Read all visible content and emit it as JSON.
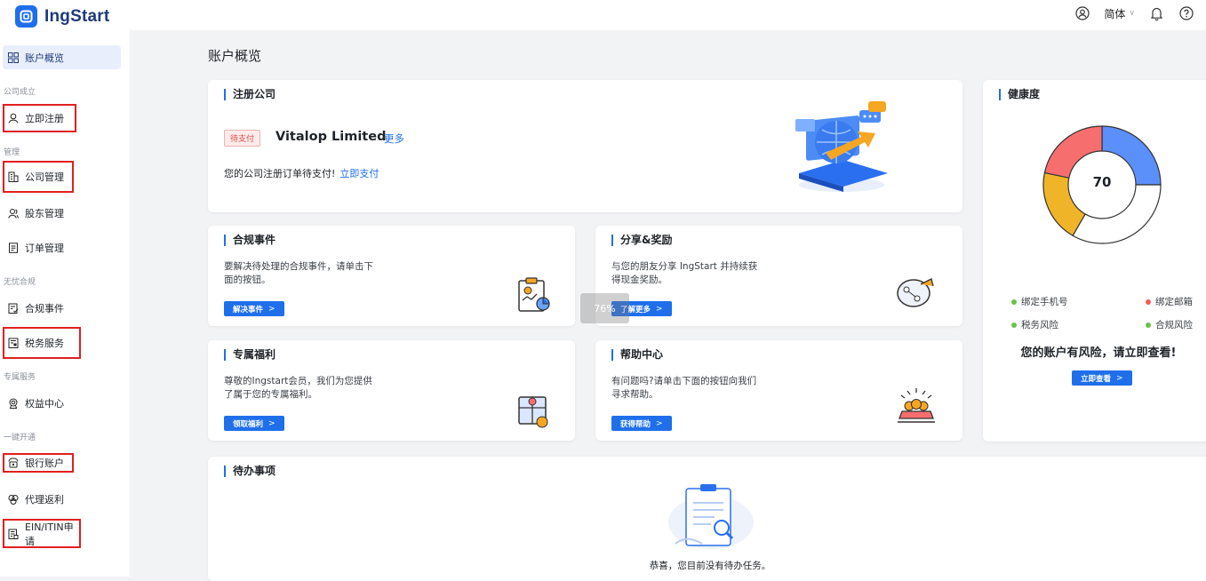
{
  "app": {
    "name": "IngStart"
  },
  "topbar": {
    "language": "简体"
  },
  "sidebar": {
    "overview": "账户概览",
    "section_company": "公司成立",
    "register": "立即注册",
    "section_manage": "管理",
    "company_mgmt": "公司管理",
    "shareholder_mgmt": "股东管理",
    "order_mgmt": "订单管理",
    "section_compliance": "无忧合规",
    "compliance_events": "合规事件",
    "tax_service": "税务服务",
    "section_exclusive": "专属服务",
    "benefits_center": "权益中心",
    "section_oneclick": "一键开通",
    "bank_account": "银行账户",
    "agent_rebate": "代理返利",
    "ein_itin": "EIN/ITIN申请"
  },
  "main": {
    "page_title": "账户概览",
    "register_card": {
      "title": "注册公司",
      "tag": "待支付",
      "company": "Vitalop Limited",
      "more": "更多",
      "message": "您的公司注册订单待支付!",
      "pay_link": "立即支付"
    },
    "compliance_card": {
      "title": "合规事件",
      "desc1": "要解决待处理的合规事件，请单击下",
      "desc2": "面的按钮。",
      "button": "解决事件"
    },
    "share_card": {
      "title": "分享&奖励",
      "desc1": "与您的朋友分享 IngStart 并持续获",
      "desc2": "得现金奖励。",
      "button": "了解更多"
    },
    "benefits_card": {
      "title": "专属福利",
      "desc1": "尊敬的Ingstart会员，我们为您提供",
      "desc2": "了属于您的专属福利。",
      "button": "领取福利"
    },
    "help_card": {
      "title": "帮助中心",
      "desc1": "有问题吗?请单击下面的按钮向我们",
      "desc2": "寻求帮助。",
      "button": "获得帮助"
    },
    "health_card": {
      "title": "健康度",
      "score": "70",
      "legend": [
        {
          "label": "绑定手机号",
          "color": "#52c41a"
        },
        {
          "label": "绑定邮箱",
          "color": "#f5222d"
        },
        {
          "label": "税务风险",
          "color": "#52c41a"
        },
        {
          "label": "合规风险",
          "color": "#52c41a"
        }
      ],
      "risk_text": "您的账户有风险，请立即查看!",
      "button": "立即查看"
    },
    "todo_card": {
      "title": "待办事项",
      "empty": "恭喜，您目前没有待办任务。"
    },
    "overlay_text": "76%"
  },
  "colors": {
    "brand": "#1f6feb",
    "donut": [
      "#5b8ff9",
      "#ffffff",
      "#f0b429",
      "#f76e6e"
    ]
  },
  "chart_data": {
    "type": "pie",
    "title": "健康度",
    "center_label": "70",
    "slices": [
      {
        "value": 25,
        "color": "#5b8ff9"
      },
      {
        "value": 33.3,
        "color": "#ffffff"
      },
      {
        "value": 20,
        "color": "#f0b429"
      },
      {
        "value": 21.7,
        "color": "#f76e6e"
      }
    ]
  }
}
